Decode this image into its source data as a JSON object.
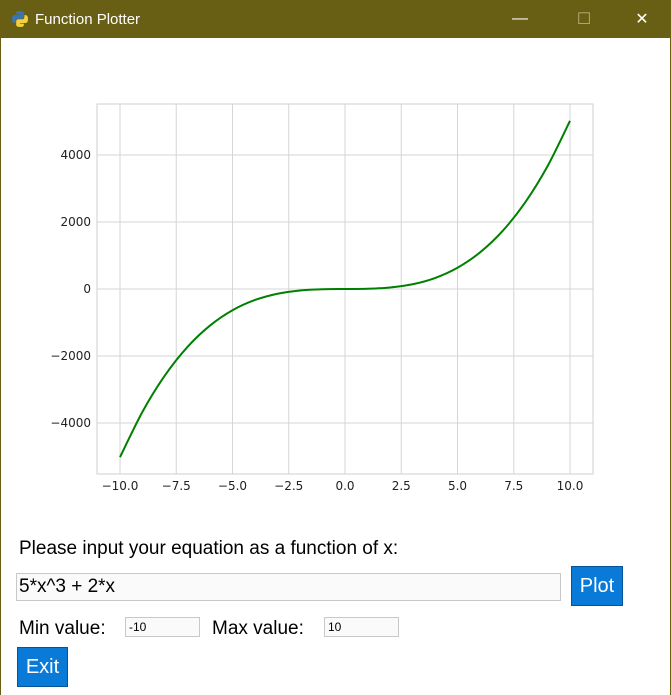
{
  "window": {
    "title": "Function Plotter",
    "controls": {
      "minimize": "—",
      "maximize": "☐",
      "close": "✕"
    }
  },
  "chart_data": {
    "type": "line",
    "title": "",
    "xlabel": "",
    "ylabel": "",
    "xlim": [
      -10.0,
      10.0
    ],
    "ylim": [
      -5000,
      5000
    ],
    "xticks": [
      "−10.0",
      "−7.5",
      "−5.0",
      "−2.5",
      "0.0",
      "2.5",
      "5.0",
      "7.5",
      "10.0"
    ],
    "yticks": [
      "4000",
      "2000",
      "0",
      "−2000",
      "−4000"
    ],
    "grid": true,
    "series": [
      {
        "color": "#008000",
        "x": [
          -10,
          -9,
          -8,
          -7,
          -6,
          -5,
          -4,
          -3,
          -2,
          -1,
          0,
          1,
          2,
          3,
          4,
          5,
          6,
          7,
          8,
          9,
          10
        ],
        "y": [
          -5020,
          -3663,
          -2576,
          -1729,
          -1092,
          -635,
          -328,
          -141,
          -44,
          -7,
          0,
          7,
          44,
          141,
          328,
          635,
          1092,
          1729,
          2576,
          3663,
          5020
        ]
      }
    ]
  },
  "form": {
    "prompt": "Please input your equation as a function of x:",
    "equation": "5*x^3 + 2*x",
    "plot_label": "Plot",
    "min_label": "Min value:",
    "min_value": "-10",
    "max_label": "Max value:",
    "max_value": "10",
    "exit_label": "Exit"
  }
}
